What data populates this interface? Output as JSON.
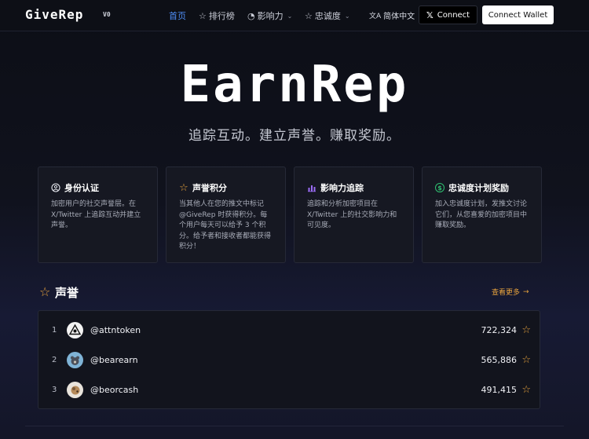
{
  "header": {
    "logo": "GiveRep",
    "version": "V0",
    "nav": [
      {
        "label": "首页",
        "icon": "",
        "dropdown": false,
        "active": true
      },
      {
        "label": "排行榜",
        "icon": "star-outline-icon",
        "dropdown": false,
        "active": false
      },
      {
        "label": "影响力",
        "icon": "pie-chart-icon",
        "dropdown": true,
        "active": false
      },
      {
        "label": "忠诚度",
        "icon": "star-outline-icon",
        "dropdown": true,
        "active": false
      }
    ],
    "language": "简体中文",
    "connect_label": "Connect",
    "wallet_label": "Connect Wallet"
  },
  "hero": {
    "title": "EarnRep",
    "subtitle": "追踪互动。建立声誉。赚取奖励。"
  },
  "features": [
    {
      "title": "身份认证",
      "icon": "user-circle-icon",
      "icon_color": "#e6e8ef",
      "desc": "加密用户的社交声誉层。在 X/Twitter 上追踪互动并建立声誉。"
    },
    {
      "title": "声誉积分",
      "icon": "star-outline-icon",
      "icon_color": "#e8a33d",
      "desc": "当其他人在您的推文中标记 @GiveRep 时获得积分。每个用户每天可以给予 3 个积分。给予者和接收者都能获得积分！"
    },
    {
      "title": "影响力追踪",
      "icon": "bar-chart-icon",
      "icon_color": "#9b6cf6",
      "desc": "追踪和分析加密项目在 X/Twitter 上的社交影响力和可见度。"
    },
    {
      "title": "忠诚度计划奖励",
      "icon": "dollar-circle-icon",
      "icon_color": "#2fbf71",
      "desc": "加入忠诚度计划，发推文讨论它们，从您喜爱的加密项目中赚取奖励。"
    }
  ],
  "reputation": {
    "title": "声誉",
    "see_more": "查看更多",
    "rows": [
      {
        "rank": "1",
        "handle": "@attntoken",
        "score": "722,324"
      },
      {
        "rank": "2",
        "handle": "@bearearn",
        "score": "565,886"
      },
      {
        "rank": "3",
        "handle": "@beorcash",
        "score": "491,415"
      }
    ]
  },
  "colors": {
    "accent_blue": "#4f8ef7",
    "accent_orange": "#e8a33d",
    "card_bg": "#161822"
  }
}
